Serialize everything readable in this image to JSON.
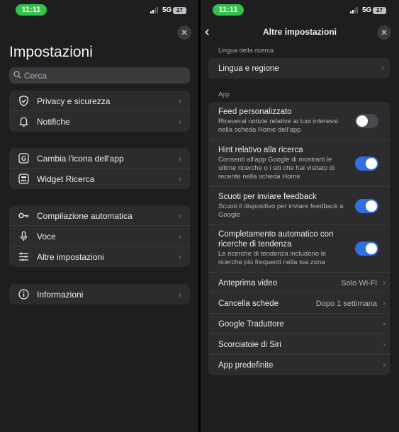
{
  "status": {
    "time": "11:11",
    "network": "5G",
    "battery": "27"
  },
  "left": {
    "title": "Impostazioni",
    "search_placeholder": "Cerca",
    "groups": [
      [
        {
          "label": "Privacy e sicurezza",
          "icon": "shield-icon"
        },
        {
          "label": "Notifiche",
          "icon": "bell-icon"
        }
      ],
      [
        {
          "label": "Cambia l'icona dell'app",
          "icon": "google-g-icon"
        },
        {
          "label": "Widget Ricerca",
          "icon": "widget-icon"
        }
      ],
      [
        {
          "label": "Compilazione automatica",
          "icon": "key-icon"
        },
        {
          "label": "Voce",
          "icon": "microphone-icon"
        },
        {
          "label": "Altre impostazioni",
          "icon": "sliders-icon"
        }
      ],
      [
        {
          "label": "Informazioni",
          "icon": "info-icon"
        }
      ]
    ]
  },
  "right": {
    "title": "Altre impostazioni",
    "section_search": "Lingua della ricerca",
    "language_row": "Lingua e regione",
    "section_app": "App",
    "toggles": [
      {
        "title": "Feed personalizzato",
        "desc": "Riceverai notizie relative ai tuoi interessi nella scheda Home dell'app",
        "on": false
      },
      {
        "title": "Hint relativo alla ricerca",
        "desc": "Consenti all'app Google di mostrarti le ultime ricerche o i siti che hai visitato di recente nella scheda Home",
        "on": true
      },
      {
        "title": "Scuoti per inviare feedback",
        "desc": "Scuoti il dispositivo per inviare feedback a Google",
        "on": true
      },
      {
        "title": "Completamento automatico con ricerche di tendenza",
        "desc": "Le ricerche di tendenza includono le ricerche più frequenti nella tua zona",
        "on": true
      }
    ],
    "nav_rows": [
      {
        "label": "Anteprima video",
        "value": "Solo Wi-Fi"
      },
      {
        "label": "Cancella schede",
        "value": "Dopo 1 settimana"
      },
      {
        "label": "Google Traduttore",
        "value": ""
      },
      {
        "label": "Scorciatoie di Siri",
        "value": ""
      },
      {
        "label": "App predefinite",
        "value": ""
      }
    ]
  },
  "colors": {
    "accent": "#2f6fe4",
    "pill": "#35c24a",
    "panel": "#2c2c2e",
    "background": "#1e1e20"
  }
}
